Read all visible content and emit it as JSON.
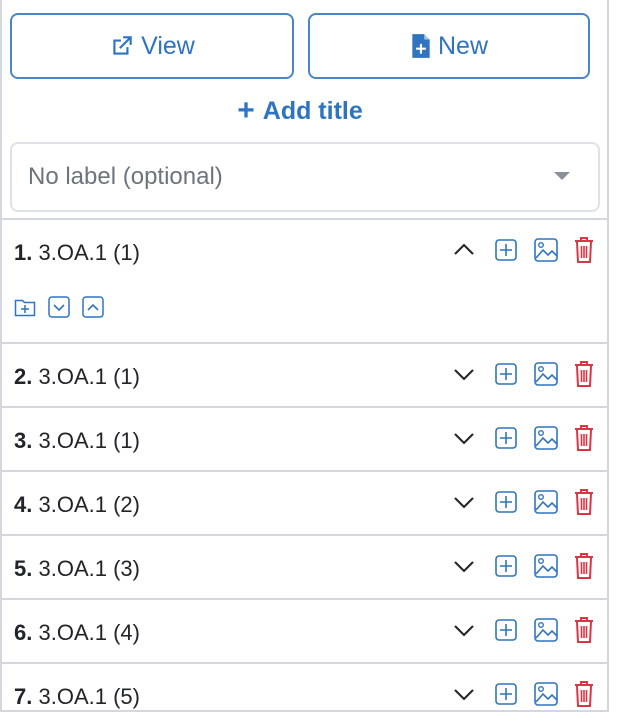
{
  "toolbar": {
    "view_label": "View",
    "new_label": "New",
    "add_title_label": "Add title"
  },
  "label_select": {
    "selected": "No label (optional)"
  },
  "colors": {
    "accent": "#2f74c0",
    "danger": "#dc3545",
    "border": "#d4d6e0"
  },
  "items": [
    {
      "number": "1.",
      "label": "3.OA.1 (1)",
      "expanded": true
    },
    {
      "number": "2.",
      "label": "3.OA.1 (1)",
      "expanded": false
    },
    {
      "number": "3.",
      "label": "3.OA.1 (1)",
      "expanded": false
    },
    {
      "number": "4.",
      "label": "3.OA.1 (2)",
      "expanded": false
    },
    {
      "number": "5.",
      "label": "3.OA.1 (3)",
      "expanded": false
    },
    {
      "number": "6.",
      "label": "3.OA.1 (4)",
      "expanded": false
    },
    {
      "number": "7.",
      "label": "3.OA.1 (5)",
      "expanded": false
    }
  ]
}
